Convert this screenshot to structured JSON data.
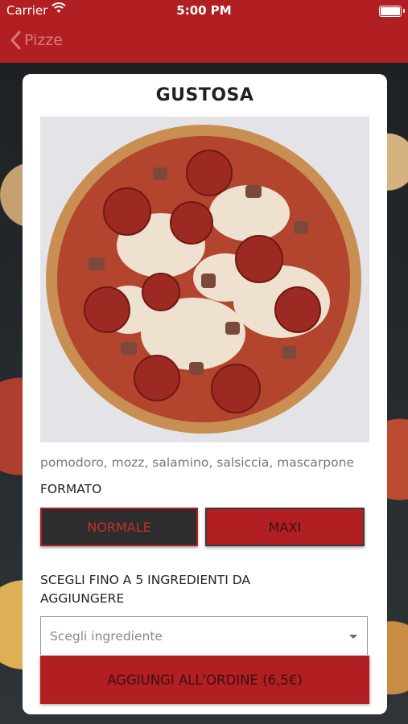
{
  "status_bar": {
    "carrier": "Carrier",
    "time": "5:00 PM"
  },
  "nav": {
    "back_label": "Pizze"
  },
  "product": {
    "name": "GUSTOSA",
    "ingredients": "pomodoro, mozz, salamino, salsiccia, mascarpone"
  },
  "format": {
    "label": "FORMATO",
    "options": [
      "NORMALE",
      "MAXI"
    ]
  },
  "extras": {
    "label": "SCEGLI FINO A 5 INGREDIENTI DA AGGIUNGERE",
    "placeholder": "Scegli ingrediente"
  },
  "add_to_order_label": "AGGIUNGI ALL'ORDINE (6,5€)",
  "colors": {
    "brand": "#b11f22",
    "dark_button": "#2d2d2d"
  }
}
